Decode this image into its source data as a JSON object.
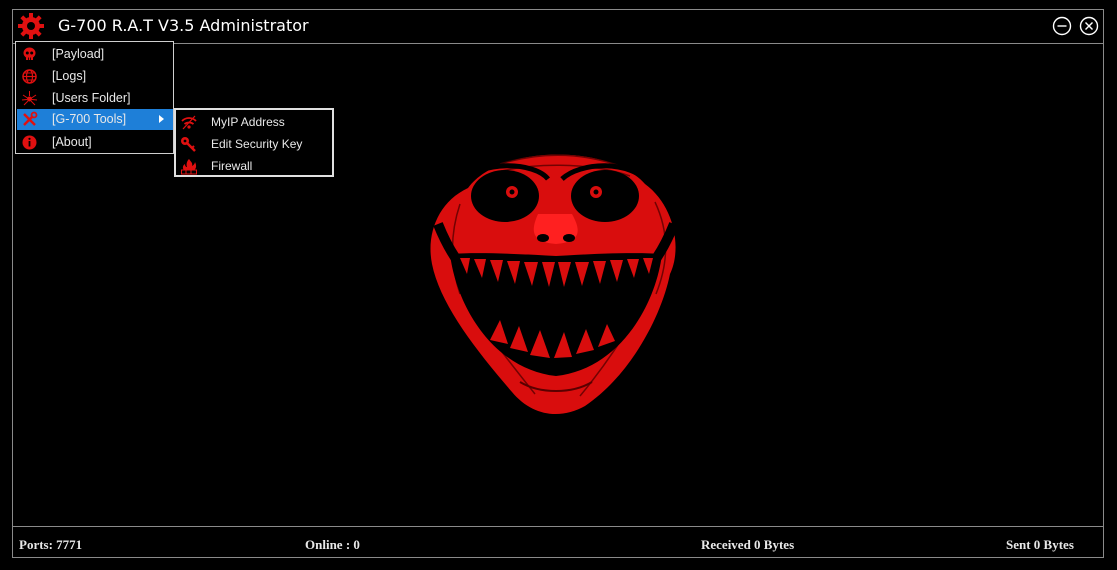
{
  "window": {
    "title": "G-700 R.A.T V3.5 Administrator"
  },
  "menu": {
    "items": [
      {
        "label": "[Payload]",
        "icon": "skull-icon"
      },
      {
        "label": "[Logs]",
        "icon": "globe-icon"
      },
      {
        "label": "[Users Folder]",
        "icon": "spider-icon"
      },
      {
        "label": "[G-700 Tools]",
        "icon": "tools-icon",
        "active": true
      },
      {
        "label": "[About]",
        "icon": "info-icon"
      }
    ]
  },
  "submenu": {
    "items": [
      {
        "label": "MyIP Address",
        "icon": "wifi-icon"
      },
      {
        "label": "Edit Security Key",
        "icon": "key-icon"
      },
      {
        "label": "Firewall",
        "icon": "firewall-icon"
      }
    ]
  },
  "status": {
    "ports": "Ports: 7771",
    "online": "Online : 0",
    "received": "Received 0 Bytes",
    "sent": "Sent 0 Bytes"
  },
  "colors": {
    "accent": "#e30d0d",
    "highlight": "#1e7fd8",
    "background": "#000000"
  }
}
